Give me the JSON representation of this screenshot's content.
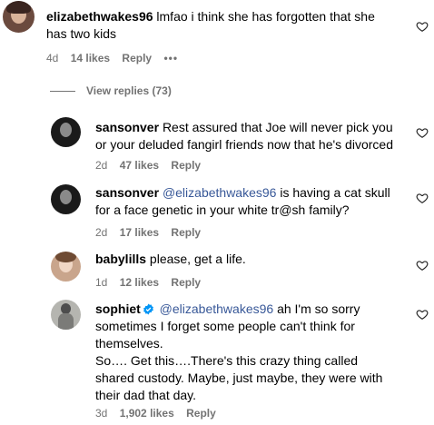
{
  "comments": [
    {
      "username": "elizabethwakes96",
      "text": "lmfao i think she has forgotten that she has two kids",
      "time": "4d",
      "likes": "14 likes",
      "reply": "Reply",
      "more": "•••"
    }
  ],
  "view_replies": "View replies (73)",
  "replies": [
    {
      "username": "sansonver",
      "text": "Rest assured that Joe will never pick you or your deluded fangirl friends now that he's divorced",
      "time": "2d",
      "likes": "47 likes",
      "reply": "Reply"
    },
    {
      "username": "sansonver",
      "mention": "@elizabethwakes96",
      "text": " is having a cat skull for a face genetic in your white tr@sh family?",
      "time": "2d",
      "likes": "17 likes",
      "reply": "Reply"
    },
    {
      "username": "babylills",
      "text": "please, get a life.",
      "time": "1d",
      "likes": "12 likes",
      "reply": "Reply"
    },
    {
      "username": "sophiet",
      "mention": "@elizabethwakes96",
      "text": " ah I'm so sorry sometimes I forget some people can't think for themselves.",
      "text2": "So…. Get this….There's this crazy thing called shared custody. Maybe, just maybe, they were with their dad that day.",
      "time": "3d",
      "likes": "1,902 likes",
      "reply": "Reply"
    }
  ],
  "colors": {
    "muted": "#737373",
    "mention": "#385898",
    "verified": "#0095f6"
  }
}
